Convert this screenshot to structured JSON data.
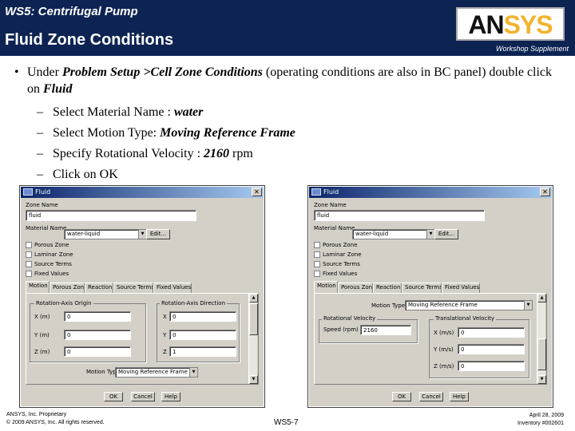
{
  "header": {
    "subtitle": "WS5: Centrifugal Pump",
    "title": "Fluid Zone Conditions",
    "supplement": "Workshop Supplement",
    "logo": {
      "part1": "AN",
      "part2": "SYS"
    }
  },
  "bullet": {
    "pre": "Under ",
    "bold1": "Problem Setup >Cell Zone Conditions",
    "mid": " (operating conditions are also in BC panel) double click on ",
    "bold2": "Fluid"
  },
  "steps": [
    {
      "pre": "Select Material Name : ",
      "bold": "water",
      "post": ""
    },
    {
      "pre": "Select Motion Type: ",
      "bold": "Moving Reference Frame",
      "post": ""
    },
    {
      "pre": "Specify Rotational Velocity : ",
      "bold": "2160",
      "post": " rpm"
    },
    {
      "pre": "Click on OK",
      "bold": "",
      "post": ""
    }
  ],
  "dialog_left": {
    "title": "Fluid",
    "zone_name_label": "Zone Name",
    "zone_name_value": "fluid",
    "material_label": "Material Name",
    "material_value": "water-liquid",
    "edit_button": "Edit...",
    "checkboxes": [
      "Porous Zone",
      "Laminar Zone",
      "Source Terms",
      "Fixed Values"
    ],
    "tabs": [
      "Motion",
      "Porous Zone",
      "Reaction",
      "Source Terms",
      "Fixed Values"
    ],
    "origin_label": "Rotation-Axis Origin",
    "direction_label": "Rotation-Axis Direction",
    "origin": [
      {
        "label": "X (m)",
        "value": "0"
      },
      {
        "label": "Y (m)",
        "value": "0"
      },
      {
        "label": "Z (m)",
        "value": "0"
      }
    ],
    "direction": [
      {
        "label": "X",
        "value": "0"
      },
      {
        "label": "Y",
        "value": "0"
      },
      {
        "label": "Z",
        "value": "1"
      }
    ],
    "motion_type_label": "Motion Type",
    "motion_type_value": "Moving Reference Frame",
    "buttons": [
      "OK",
      "Cancel",
      "Help"
    ]
  },
  "dialog_right": {
    "title": "Fluid",
    "zone_name_label": "Zone Name",
    "zone_name_value": "fluid",
    "material_label": "Material Name",
    "material_value": "water-liquid",
    "edit_button": "Edit...",
    "checkboxes": [
      "Porous Zone",
      "Laminar Zone",
      "Source Terms",
      "Fixed Values"
    ],
    "tabs": [
      "Motion",
      "Porous Zone",
      "Reaction",
      "Source Terms",
      "Fixed Values"
    ],
    "motion_type_label": "Motion Type",
    "motion_type_value": "Moving Reference Frame",
    "rot_vel_label": "Rotational Velocity",
    "speed_label": "Speed (rpm)",
    "speed_value": "2160",
    "trans_vel_label": "Translational Velocity",
    "trans": [
      {
        "label": "X (m/s)",
        "value": "0"
      },
      {
        "label": "Y (m/s)",
        "value": "0"
      },
      {
        "label": "Z (m/s)",
        "value": "0"
      }
    ],
    "buttons": [
      "OK",
      "Cancel",
      "Help"
    ]
  },
  "footer": {
    "left1": "ANSYS, Inc. Proprietary",
    "left2": "© 2009 ANSYS, Inc.  All rights reserved.",
    "center": "WS5-7",
    "right1": "April 28, 2009",
    "right2": "Inventory #002601"
  }
}
